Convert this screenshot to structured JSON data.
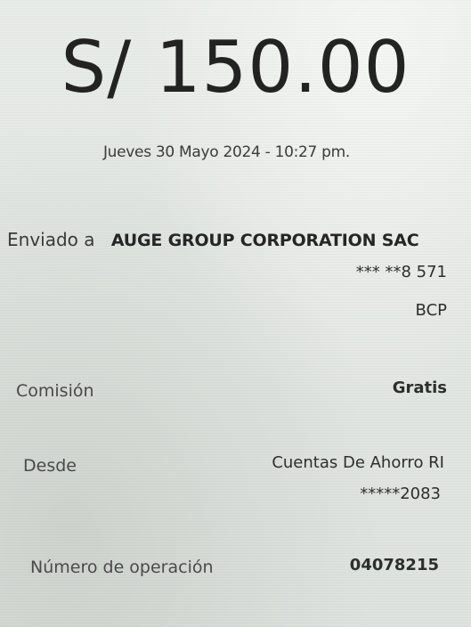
{
  "amount": "S/ 150.00",
  "datetime": "Jueves 30 Mayo 2024 - 10:27 pm.",
  "recipient": {
    "label": "Enviado a",
    "name": "AUGE GROUP CORPORATION SAC",
    "account": "*** **8 571",
    "bank": "BCP"
  },
  "commission": {
    "label": "Comisión",
    "value": "Gratis"
  },
  "from": {
    "label": "Desde",
    "account_name": "Cuentas De Ahorro RI",
    "account_number": "*****2083"
  },
  "operation": {
    "label": "Número de operación",
    "value": "04078215"
  }
}
